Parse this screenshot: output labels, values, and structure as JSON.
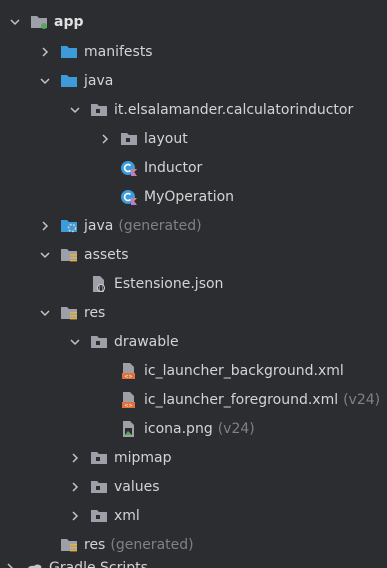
{
  "tree": {
    "app": {
      "label": "app"
    },
    "manifests": {
      "label": "manifests"
    },
    "java": {
      "label": "java"
    },
    "package": {
      "label": "it.elsalamander.calculatorinductor"
    },
    "layout": {
      "label": "layout"
    },
    "inductor": {
      "label": "Inductor"
    },
    "myoperation": {
      "label": "MyOperation"
    },
    "java_generated": {
      "label": "java",
      "suffix": "(generated)"
    },
    "assets": {
      "label": "assets"
    },
    "estensione": {
      "label": "Estensione.json"
    },
    "res": {
      "label": "res"
    },
    "drawable": {
      "label": "drawable"
    },
    "ic_bg": {
      "label": "ic_launcher_background.xml"
    },
    "ic_fg": {
      "label": "ic_launcher_foreground.xml",
      "suffix": "(v24)"
    },
    "icona": {
      "label": "icona.png",
      "suffix": "(v24)"
    },
    "mipmap": {
      "label": "mipmap"
    },
    "values": {
      "label": "values"
    },
    "xml": {
      "label": "xml"
    },
    "res_generated": {
      "label": "res",
      "suffix": "(generated)"
    },
    "gradle": {
      "label": "Gradle Scripts"
    }
  },
  "colors": {
    "background": "#2b2d30",
    "folder_blue": "#3d9bd9",
    "folder_gray": "#9da0a8",
    "accent_green": "#54a857",
    "suffix": "#7f8185"
  }
}
